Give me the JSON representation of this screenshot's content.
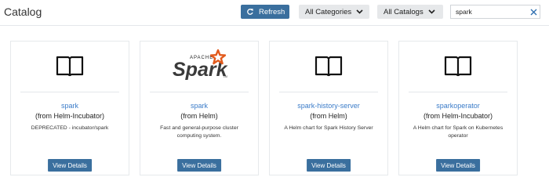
{
  "header": {
    "title": "Catalog",
    "refresh_label": "Refresh",
    "category_dropdown": "All Categories",
    "catalog_dropdown": "All Catalogs",
    "search_value": "spark"
  },
  "icons": {
    "refresh": "refresh-icon",
    "chevron": "chevron-down-icon",
    "clear": "close-icon",
    "book": "book-icon"
  },
  "colors": {
    "primary_button": "#3a6f9e",
    "link": "#3a7bc8",
    "spark_orange": "#e25a1c"
  },
  "cards": [
    {
      "logo": "book-icon",
      "name": "spark",
      "source": "(from Helm-Incubator)",
      "description": "DEPRECATED - incubator/spark",
      "button": "View Details"
    },
    {
      "logo": "apache-spark-logo",
      "logo_small_text": "APACHE",
      "logo_text": "Spark",
      "logo_mark": "TM",
      "name": "spark",
      "source": "(from Helm)",
      "description": "Fast and general-purpose cluster computing system.",
      "button": "View Details"
    },
    {
      "logo": "book-icon",
      "name": "spark-history-server",
      "source": "(from Helm)",
      "description": "A Helm chart for Spark History Server",
      "button": "View Details"
    },
    {
      "logo": "book-icon",
      "name": "sparkoperator",
      "source": "(from Helm-Incubator)",
      "description": "A Helm chart for Spark on Kubernetes operator",
      "button": "View Details"
    }
  ]
}
